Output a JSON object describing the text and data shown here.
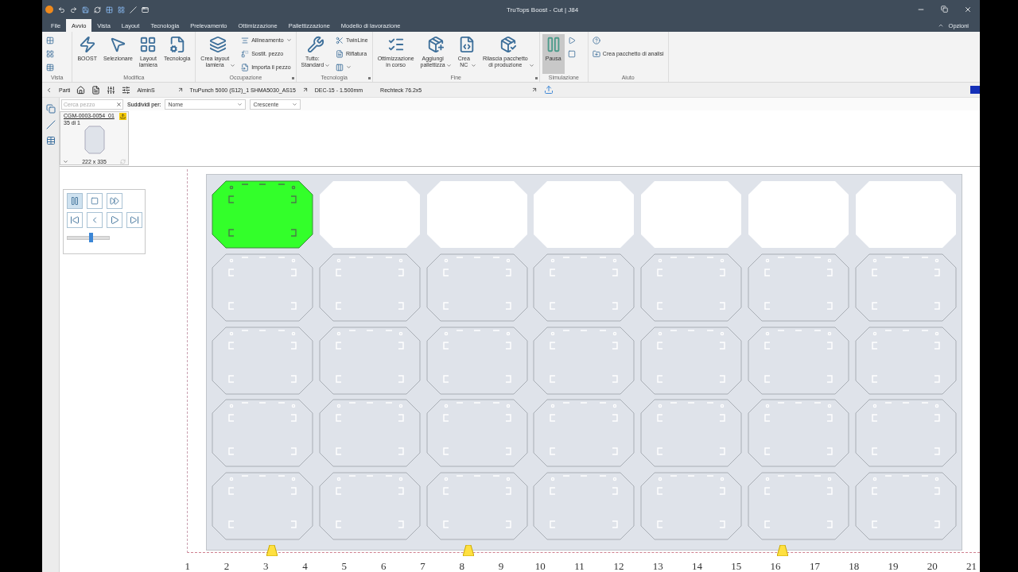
{
  "window": {
    "title": "TruTops Boost - Cut | J84"
  },
  "menu_tabs": [
    {
      "label": "File",
      "selected": false
    },
    {
      "label": "Avvio",
      "selected": true
    },
    {
      "label": "Vista",
      "selected": false
    },
    {
      "label": "Layout",
      "selected": false
    },
    {
      "label": "Tecnologia",
      "selected": false
    },
    {
      "label": "Prelevamento",
      "selected": false
    },
    {
      "label": "Ottimizzazione",
      "selected": false
    },
    {
      "label": "Pallettizzazione",
      "selected": false
    },
    {
      "label": "Modello di lavorazione",
      "selected": false
    }
  ],
  "options_label": "Opzioni",
  "ribbon": [
    {
      "label": "Vista",
      "small": [
        {
          "kind": "icon"
        },
        {
          "kind": "icon"
        },
        {
          "kind": "icon"
        }
      ]
    },
    {
      "label": "Modifica",
      "large": [
        {
          "label": "BOOST",
          "selected": false
        },
        {
          "label": "Selezionare",
          "selected": false
        },
        {
          "label": "Layout\nlamiera",
          "selected": false
        },
        {
          "label": "Tecnologia",
          "selected": false
        }
      ]
    },
    {
      "label": "Occupazione",
      "launcher": true,
      "large": [
        {
          "label": "Crea layout\nlamiera",
          "dropdown": true,
          "selected": false
        }
      ],
      "small": [
        {
          "kind": "text",
          "label": "Allineamento",
          "dropdown": true
        },
        {
          "kind": "text",
          "label": "Sostit. pezzo"
        },
        {
          "kind": "text",
          "label": "Importa il pezzo"
        }
      ]
    },
    {
      "label": "Tecnologia",
      "launcher": true,
      "large": [
        {
          "label": "Tutto:\nStandard",
          "dropdown": true,
          "selected": false
        }
      ],
      "small": [
        {
          "kind": "text",
          "label": "TwinLine"
        },
        {
          "kind": "text",
          "label": "Riflatura"
        },
        {
          "kind": "icon",
          "dropdown": true
        }
      ]
    },
    {
      "label": "Fine",
      "launcher": true,
      "large": [
        {
          "label": "Ottimizzazione\nin corso",
          "selected": false
        },
        {
          "label": "Aggiungi\npallettizza",
          "dropdown": true,
          "selected": false
        },
        {
          "label": "Crea\nNC",
          "dropdown": true,
          "selected": false
        },
        {
          "label": "Rilascia pacchetto\ndi produzione",
          "dropdown": true,
          "selected": false
        }
      ]
    },
    {
      "label": "Simulazione",
      "large": [
        {
          "label": "Pausa",
          "selected": true
        }
      ],
      "small": [
        {
          "kind": "icon"
        },
        {
          "kind": "icon"
        }
      ]
    },
    {
      "label": "Aiuto",
      "small": [
        {
          "kind": "icon"
        },
        {
          "kind": "text",
          "label": "Crea pacchetto di analisi"
        }
      ]
    }
  ],
  "parts_bar": {
    "title": "Parti",
    "material": "AlminS",
    "machine": "TruPunch 5000 (S12)_1 SHMA5030_AS15",
    "thickness": "DEC-15 - 1.500mm",
    "tool": "Rechteck 76.2x5"
  },
  "filter": {
    "search_placeholder": "Cerca pezzo",
    "sort_label": "Suddividi per:",
    "sort_by": "Nome",
    "order": "Crescente"
  },
  "part_card": {
    "name": "CGM-0003-0054_01",
    "count": "35 di 1",
    "size": "222 x 335"
  },
  "simulation": {
    "paused": true,
    "speed": {
      "level": 0.55
    }
  },
  "sheet": {
    "parts": [
      {
        "kind": "cut"
      },
      {
        "kind": "removed"
      },
      {
        "kind": "removed"
      },
      {
        "kind": "removed"
      },
      {
        "kind": "removed"
      },
      {
        "kind": "removed"
      },
      {
        "kind": "removed"
      },
      {
        "kind": "pending"
      },
      {
        "kind": "pending"
      },
      {
        "kind": "pending"
      },
      {
        "kind": "pending"
      },
      {
        "kind": "pending"
      },
      {
        "kind": "pending"
      },
      {
        "kind": "pending"
      },
      {
        "kind": "pending"
      },
      {
        "kind": "pending"
      },
      {
        "kind": "pending"
      },
      {
        "kind": "pending"
      },
      {
        "kind": "pending"
      },
      {
        "kind": "pending"
      },
      {
        "kind": "pending"
      },
      {
        "kind": "pending"
      },
      {
        "kind": "pending"
      },
      {
        "kind": "pending"
      },
      {
        "kind": "pending"
      },
      {
        "kind": "pending"
      },
      {
        "kind": "pending"
      },
      {
        "kind": "pending"
      },
      {
        "kind": "pending"
      },
      {
        "kind": "pending"
      },
      {
        "kind": "pending"
      },
      {
        "kind": "pending"
      },
      {
        "kind": "pending"
      },
      {
        "kind": "pending"
      },
      {
        "kind": "pending"
      }
    ]
  },
  "ruler": [
    "1",
    "2",
    "3",
    "4",
    "5",
    "6",
    "7",
    "8",
    "9",
    "10",
    "11",
    "12",
    "13",
    "14",
    "15",
    "16",
    "17",
    "18",
    "19",
    "20",
    "21"
  ]
}
